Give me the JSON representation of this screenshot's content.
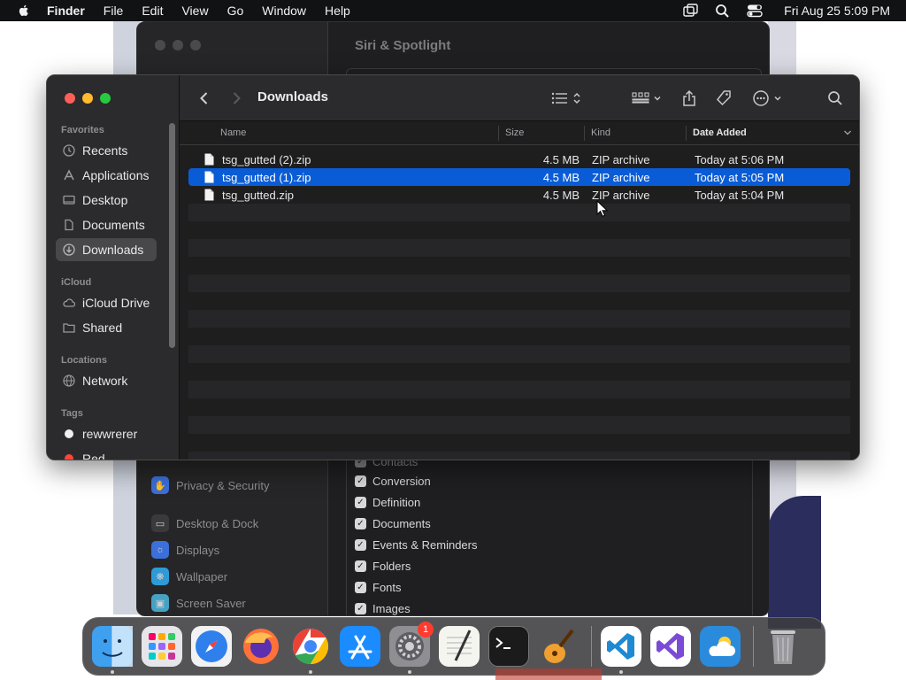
{
  "menubar": {
    "app_name": "Finder",
    "menus": [
      "File",
      "Edit",
      "View",
      "Go",
      "Window",
      "Help"
    ],
    "clock": "Fri Aug 25  5:09 PM",
    "status_icons": [
      "screen-mirroring-icon",
      "spotlight-search-icon",
      "control-center-icon"
    ]
  },
  "settings_window": {
    "title": "Siri & Spotlight",
    "sidebar_items": [
      {
        "label": "Privacy & Security",
        "icon": "hand-icon"
      },
      {
        "label": "Desktop & Dock",
        "icon": "dock-icon"
      },
      {
        "label": "Displays",
        "icon": "display-icon"
      },
      {
        "label": "Wallpaper",
        "icon": "wallpaper-icon"
      },
      {
        "label": "Screen Saver",
        "icon": "screen-saver-icon"
      }
    ],
    "partial_row": "Contacts",
    "categories": [
      "Conversion",
      "Definition",
      "Documents",
      "Events & Reminders",
      "Folders",
      "Fonts",
      "Images"
    ]
  },
  "finder": {
    "title": "Downloads",
    "sidebar": {
      "favorites_header": "Favorites",
      "favorites": [
        "Recents",
        "Applications",
        "Desktop",
        "Documents",
        "Downloads"
      ],
      "icloud_header": "iCloud",
      "icloud": [
        "iCloud Drive",
        "Shared"
      ],
      "locations_header": "Locations",
      "locations": [
        "Network"
      ],
      "tags_header": "Tags",
      "tags": [
        "rewwrerer",
        "Red"
      ],
      "active_item": "Downloads"
    },
    "columns": {
      "name": "Name",
      "size": "Size",
      "kind": "Kind",
      "date_added": "Date Added"
    },
    "sorted_column": "Date Added",
    "files": [
      {
        "name": "tsg_gutted (2).zip",
        "size": "4.5 MB",
        "kind": "ZIP archive",
        "date": "Today at 5:06 PM",
        "selected": false
      },
      {
        "name": "tsg_gutted (1).zip",
        "size": "4.5 MB",
        "kind": "ZIP archive",
        "date": "Today at 5:05 PM",
        "selected": true
      },
      {
        "name": "tsg_gutted.zip",
        "size": "4.5 MB",
        "kind": "ZIP archive",
        "date": "Today at 5:04 PM",
        "selected": false
      }
    ]
  },
  "dock": {
    "apps": [
      {
        "name": "Finder",
        "icon": "finder-icon",
        "color": "#1e88e5",
        "running": true
      },
      {
        "name": "Launchpad",
        "icon": "launchpad-icon",
        "color": "#d9d9de",
        "running": false
      },
      {
        "name": "Safari",
        "icon": "safari-icon",
        "color": "#2f80ed",
        "running": false
      },
      {
        "name": "Firefox",
        "icon": "firefox-icon",
        "color": "#ff7139",
        "running": false
      },
      {
        "name": "Chrome",
        "icon": "chrome-icon",
        "color": "#34a853",
        "running": true
      },
      {
        "name": "App Store",
        "icon": "app-store-icon",
        "color": "#1a8cff",
        "running": false
      },
      {
        "name": "System Settings",
        "icon": "system-settings-icon",
        "color": "#8e8e93",
        "running": true,
        "badge": "1"
      },
      {
        "name": "TextEdit",
        "icon": "textedit-icon",
        "color": "#f5f5f0",
        "running": false
      },
      {
        "name": "Terminal",
        "icon": "terminal-icon",
        "color": "#1b1b1b",
        "running": false
      },
      {
        "name": "GarageBand",
        "icon": "garageband-icon",
        "color": "#f0a030",
        "running": false
      },
      {
        "name": "Visual Studio Code",
        "icon": "vscode-icon",
        "color": "#ffffff",
        "running": true
      },
      {
        "name": "Visual Studio",
        "icon": "visual-studio-icon",
        "color": "#ffffff",
        "running": false
      },
      {
        "name": "Weather",
        "icon": "weather-icon",
        "color": "#2a8bdc",
        "running": false
      },
      {
        "name": "Trash",
        "icon": "trash-icon",
        "color": "#9a9a9e",
        "running": false
      }
    ]
  },
  "colors": {
    "selection_blue": "#0a5cd6",
    "window_bg": "#1e1e1e",
    "sidebar_bg": "#2b2b2d"
  }
}
